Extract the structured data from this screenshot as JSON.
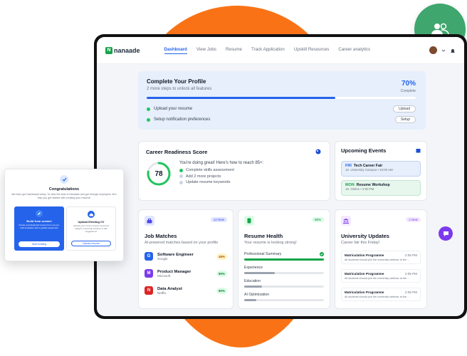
{
  "brand": {
    "name": "nanaade",
    "mark": "N"
  },
  "nav": {
    "links": [
      {
        "label": "Dashboard"
      },
      {
        "label": "View Jobs"
      },
      {
        "label": "Resume"
      },
      {
        "label": "Track Application"
      },
      {
        "label": "Upskill Resources"
      },
      {
        "label": "Career analytics"
      }
    ]
  },
  "profile_progress": {
    "title": "Complete Your Profile",
    "subtitle": "2 more steps to unlock all features",
    "percent_text": "70%",
    "percent_value": 0.7,
    "percent_label": "Complete",
    "tasks": [
      {
        "label": "Upload your resume",
        "button": "Upload"
      },
      {
        "label": "Setup notification preferences",
        "button": "Setup"
      }
    ]
  },
  "readiness": {
    "title": "Career Readiness Score",
    "score": "78",
    "score_value": 0.78,
    "message": "You're doing great! Here's how to reach 85+:",
    "steps": [
      {
        "label": "Complete skills assessment",
        "done": true
      },
      {
        "label": "Add 2 more projects",
        "done": false
      },
      {
        "label": "Update resume keywords",
        "done": false
      }
    ]
  },
  "events": {
    "title": "Upcoming Events",
    "items": [
      {
        "day": "FRI",
        "date": "15",
        "title": "Tech Career Fair",
        "detail": "University Campus • 10:00 AM"
      },
      {
        "day": "MON",
        "date": "18",
        "title": "Resume Workshop",
        "detail": "Online • 2:00 PM"
      }
    ]
  },
  "jobs": {
    "title": "Job Matches",
    "badge": "12 New",
    "subtitle": "AI-powered matches based on your profile",
    "items": [
      {
        "initial": "G",
        "title": "Software Engineer",
        "company": "Google",
        "match": "48%",
        "color": "#2563eb"
      },
      {
        "initial": "M",
        "title": "Product Manager",
        "company": "Microsoft",
        "match": "80%",
        "color": "#7c3aed"
      },
      {
        "initial": "N",
        "title": "Data Analyst",
        "company": "Netflix",
        "match": "80%",
        "color": "#dc2626"
      }
    ]
  },
  "health": {
    "title": "Resume Health",
    "badge": "85%",
    "subtitle": "Your resume is looking strong!",
    "rows": [
      {
        "label": "Professional Summary",
        "value": 1.0,
        "color": "#16a34a",
        "check": true
      },
      {
        "label": "Experience",
        "value": 0.38,
        "color": "#9ca3af"
      },
      {
        "label": "Education",
        "value": 0.22,
        "color": "#9ca3af"
      },
      {
        "label": "AI Optimization",
        "value": 0.15,
        "color": "#9ca3af"
      }
    ]
  },
  "university": {
    "title": "University Updates",
    "badge": "2 New",
    "subtitle": "Career fair this Friday!",
    "items": [
      {
        "title": "Matriculation Programme",
        "time": "2:05 PM",
        "desc": "All students should join the university webinar at the ..."
      },
      {
        "title": "Matriculation Programme",
        "time": "2:05 PM",
        "desc": "All students should join the university webinar at the ..."
      },
      {
        "title": "Matriculation Programme",
        "time": "2:05 PM",
        "desc": "All students should join the university webinar at the ..."
      }
    ]
  },
  "popup": {
    "title": "Congratulations",
    "description": "We have got Dashboard setup. To view the best of Nanaade and get through employers. let's help you get started with creating your resume!",
    "options": [
      {
        "title": "Build from scratch",
        "desc": "Create a professional resume from our pre-built templates with a guided experience",
        "button": "Start building"
      },
      {
        "title": "Upload Existing CV",
        "desc": "Upload your current resume and let AI analyze it and help enhance it with suggestions",
        "button": "Upload resume"
      }
    ]
  },
  "colors": {
    "accent": "#2563eb",
    "orange": "#f97316",
    "green": "#3fa66d"
  },
  "icons": [
    "users-icon",
    "bell-icon",
    "chevron-down-icon",
    "palette-icon",
    "calendar-icon",
    "briefcase-icon",
    "document-icon",
    "university-icon",
    "chat-icon",
    "check-icon",
    "cloud-upload-icon",
    "pencil-icon"
  ]
}
